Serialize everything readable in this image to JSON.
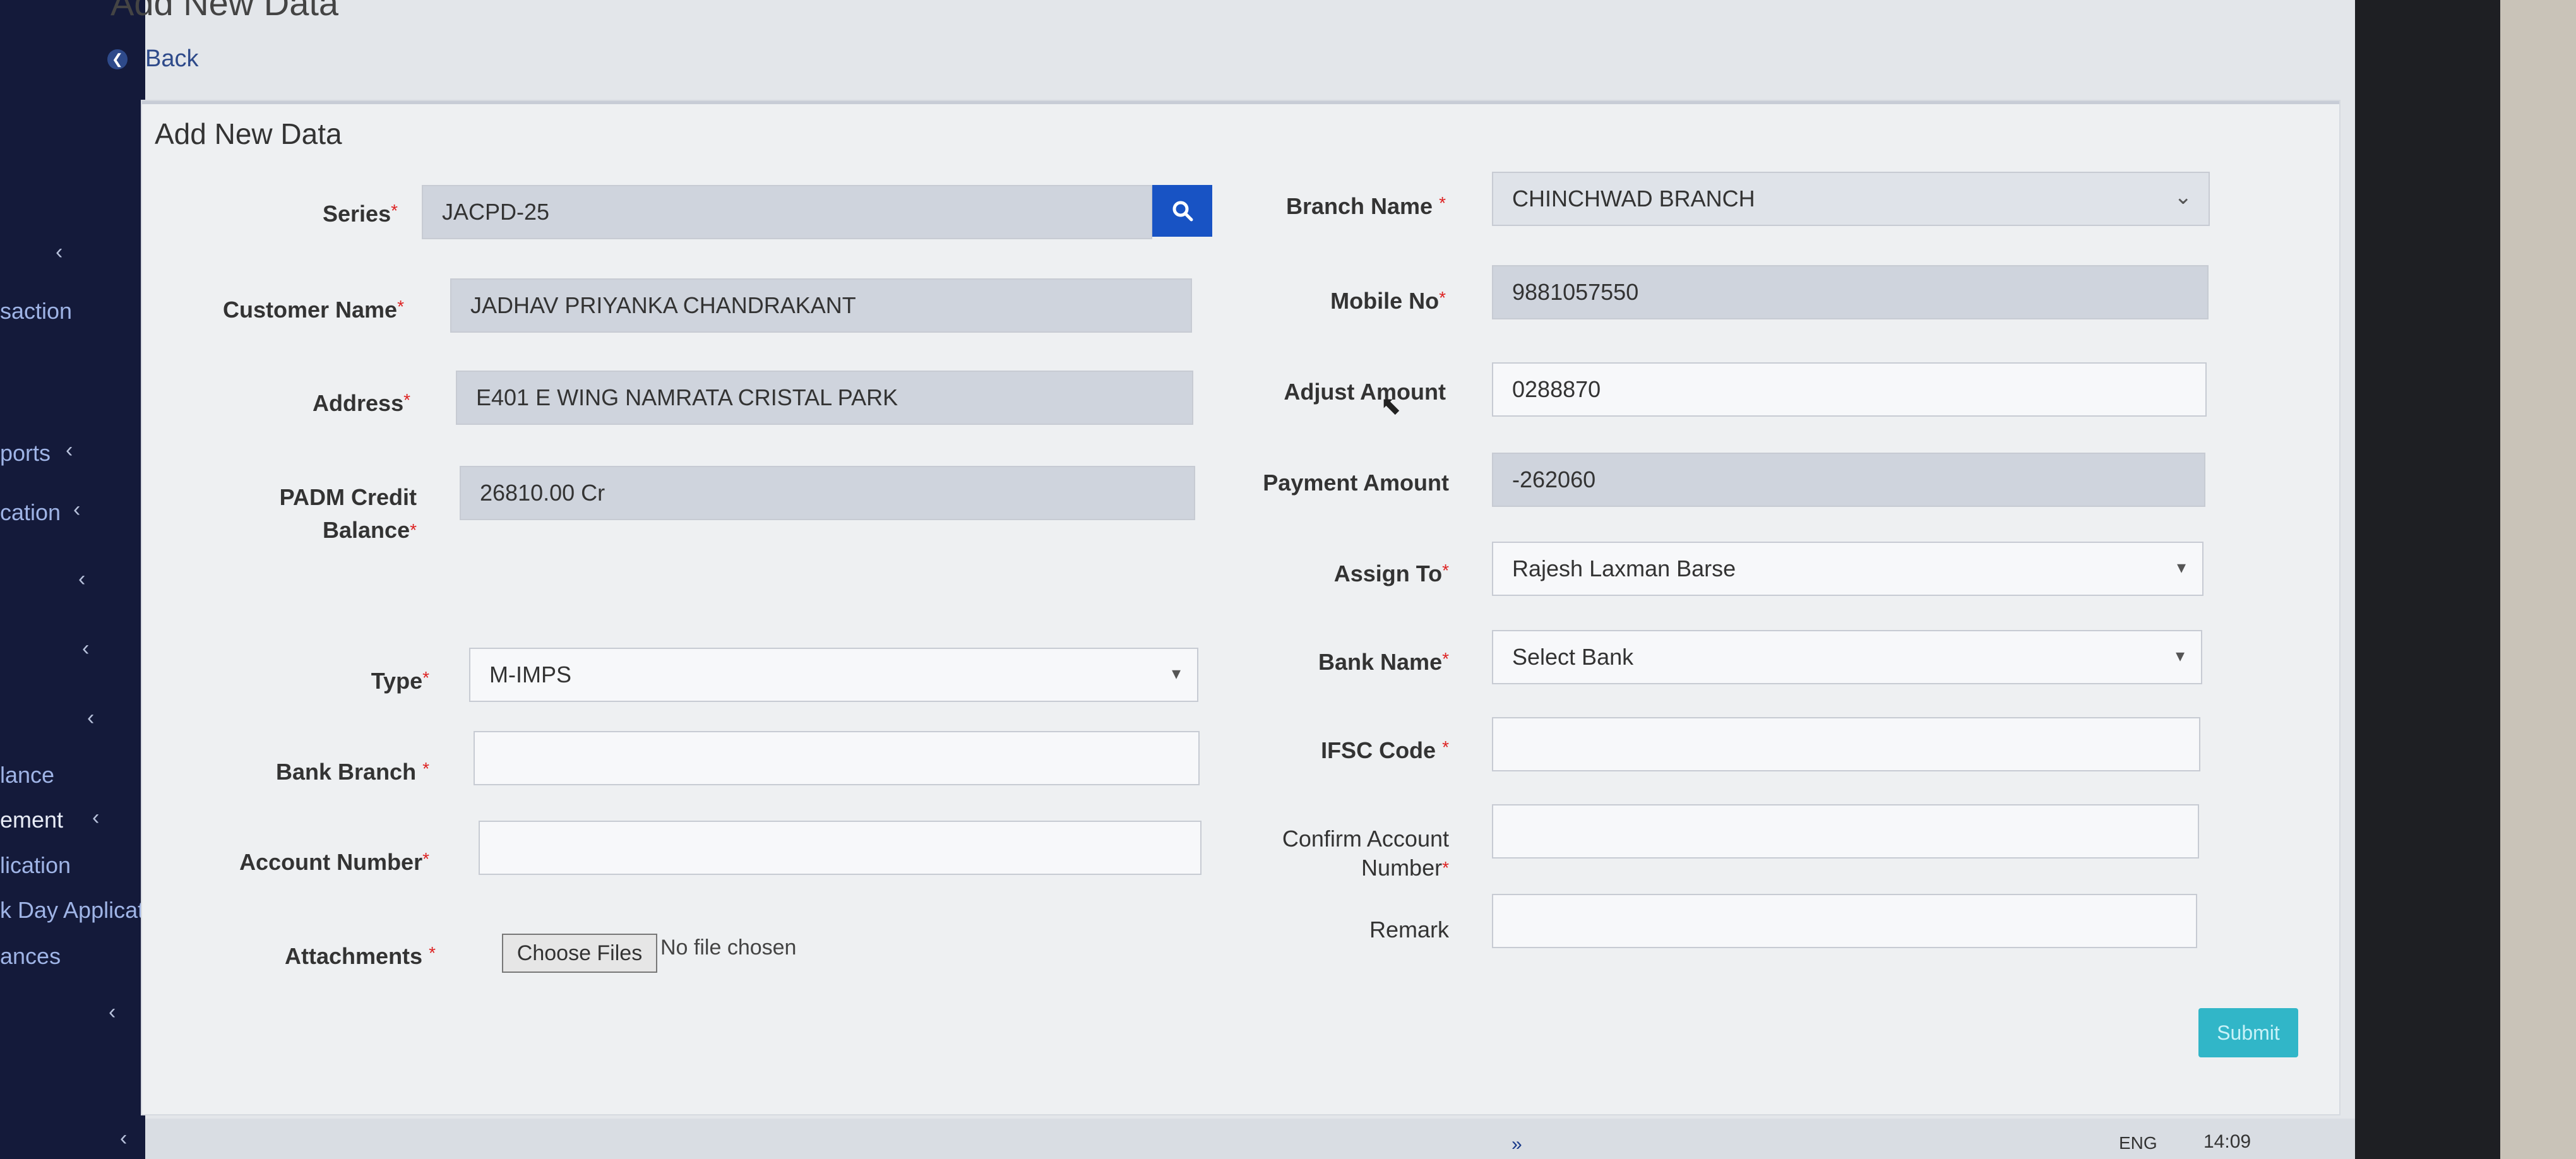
{
  "page": {
    "heading": "Add New Data",
    "back_label": "Back",
    "card_title": "Add New Data"
  },
  "sidebar": {
    "items": [
      {
        "label": "saction"
      },
      {
        "label": "ports"
      },
      {
        "label": "cation"
      },
      {
        "label": "lance"
      },
      {
        "label": "ement"
      },
      {
        "label": "lication"
      },
      {
        "label": "k Day Applicati"
      },
      {
        "label": "ances"
      }
    ]
  },
  "form": {
    "series": {
      "label": "Series",
      "value": "JACPD-25"
    },
    "customer_name": {
      "label": "Customer Name",
      "value": "JADHAV PRIYANKA CHANDRAKANT"
    },
    "address": {
      "label": "Address",
      "value": "E401 E  WING NAMRATA CRISTAL PARK"
    },
    "padm_credit": {
      "label_line1": "PADM Credit",
      "label_line2": "Balance",
      "value": "26810.00 Cr"
    },
    "type": {
      "label": "Type",
      "value": "M-IMPS"
    },
    "bank_branch": {
      "label": "Bank Branch",
      "value": ""
    },
    "account_number": {
      "label": "Account Number",
      "value": ""
    },
    "attachments": {
      "label": "Attachments",
      "button": "Choose Files",
      "status": "No file chosen"
    },
    "branch_name": {
      "label": "Branch Name",
      "value": "CHINCHWAD BRANCH"
    },
    "mobile_no": {
      "label": "Mobile No",
      "value": "9881057550"
    },
    "adjust_amount": {
      "label": "Adjust Amount",
      "value": "0288870"
    },
    "payment_amount": {
      "label": "Payment Amount",
      "value": "-262060"
    },
    "assign_to": {
      "label": "Assign To",
      "value": "Rajesh Laxman Barse"
    },
    "bank_name": {
      "label": "Bank Name",
      "value": "Select Bank"
    },
    "ifsc_code": {
      "label": "IFSC Code",
      "value": ""
    },
    "confirm_account": {
      "label_line1": "Confirm Account",
      "label_line2": "Number",
      "value": ""
    },
    "remark": {
      "label": "Remark",
      "value": ""
    },
    "required_mark": "*",
    "submit_label": "Submit"
  },
  "taskbar": {
    "more": "»",
    "language": "ENG",
    "time": "14:09"
  },
  "colors": {
    "sidebar_bg": "#141a3a",
    "search_button": "#1853c4",
    "submit_button": "#31b6c8",
    "required_star": "#d22"
  }
}
